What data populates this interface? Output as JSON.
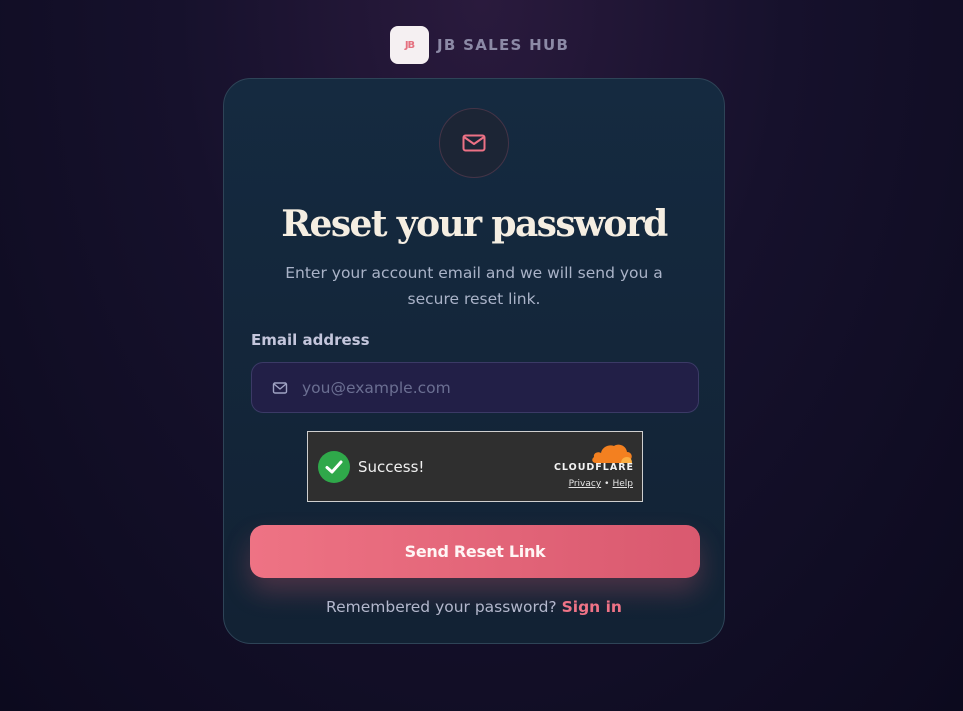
{
  "brand": {
    "logo_text": "JB",
    "name": "JB SALES HUB"
  },
  "card": {
    "icon": "mail-icon",
    "title": "Reset your password",
    "subtitle": "Enter your account email and we will send you a secure reset link."
  },
  "form": {
    "email_label": "Email address",
    "email_placeholder": "you@example.com",
    "email_value": "",
    "submit_label": "Send Reset Link"
  },
  "captcha": {
    "status_text": "Success!",
    "provider": "CLOUDFLARE",
    "privacy_link": "Privacy",
    "separator": "•",
    "help_link": "Help"
  },
  "footer": {
    "prompt": "Remembered your password?",
    "signin_link": "Sign in"
  },
  "colors": {
    "accent": "#e96a7e",
    "card_bg": "#142638",
    "input_bg": "#221f47",
    "title": "#f5eee2",
    "success": "#2fa84a",
    "cloudflare_orange": "#f38020"
  }
}
